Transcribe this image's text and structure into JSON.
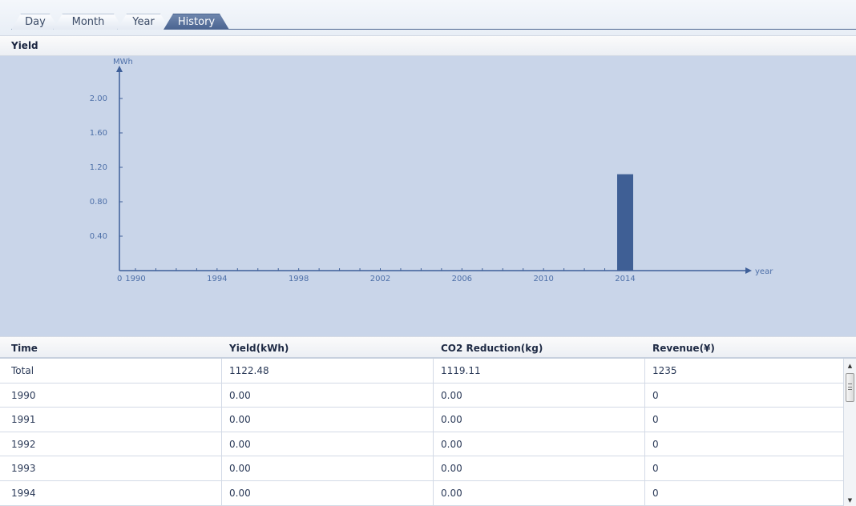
{
  "tabs": [
    {
      "label": "Day",
      "active": false
    },
    {
      "label": "Month",
      "active": false
    },
    {
      "label": "Year",
      "active": false
    },
    {
      "label": "History",
      "active": true
    }
  ],
  "yield_section": {
    "title": "Yield"
  },
  "chart_data": {
    "type": "bar",
    "ylabel": "MWh",
    "xlabel": "year",
    "origin_label": "0",
    "ylim": [
      0,
      2.0
    ],
    "y_ticks": [
      "0.40",
      "0.80",
      "1.20",
      "1.60",
      "2.00"
    ],
    "x_tick_labels": [
      "1990",
      "1994",
      "1998",
      "2002",
      "2006",
      "2010",
      "2014"
    ],
    "x_start": 1990,
    "x_end": 2014,
    "values": [
      {
        "x": 2014,
        "y": 1.12
      }
    ],
    "grid": false,
    "colors": {
      "bar": "#3f5f95",
      "axis": "#3e5f99",
      "background": "#c9d5e9"
    }
  },
  "table": {
    "columns": [
      "Time",
      "Yield(kWh)",
      "CO2 Reduction(kg)",
      "Revenue(¥)"
    ],
    "rows": [
      [
        "Total",
        "1122.48",
        "1119.11",
        "1235"
      ],
      [
        "1990",
        "0.00",
        "0.00",
        "0"
      ],
      [
        "1991",
        "0.00",
        "0.00",
        "0"
      ],
      [
        "1992",
        "0.00",
        "0.00",
        "0"
      ],
      [
        "1993",
        "0.00",
        "0.00",
        "0"
      ],
      [
        "1994",
        "0.00",
        "0.00",
        "0"
      ]
    ]
  },
  "scrollbar": {
    "up_icon": "triangle-up-icon",
    "down_icon": "triangle-down-icon"
  }
}
